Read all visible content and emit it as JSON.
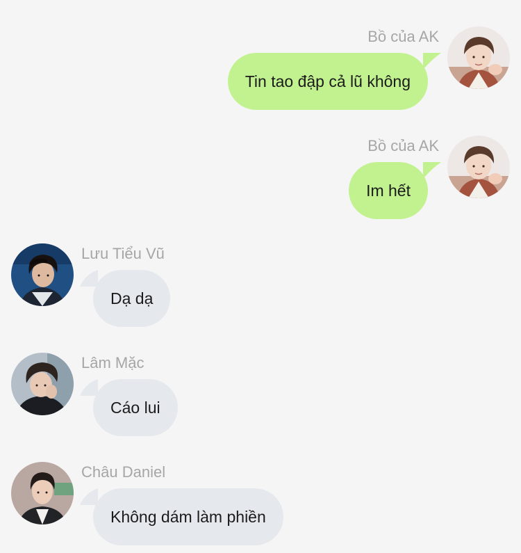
{
  "colors": {
    "background": "#f5f5f5",
    "outgoing_bubble": "#c2f28f",
    "incoming_bubble": "#e5e8ec",
    "sender_name": "#a6a6a6",
    "message_text": "#1b1b1b"
  },
  "messages": [
    {
      "sender": "Bồ của AK",
      "text": "Tin tao đập cả lũ không",
      "direction": "outgoing",
      "avatar_icon": "avatar-bo-cua-ak-icon"
    },
    {
      "sender": "Bồ của AK",
      "text": "Im hết",
      "direction": "outgoing",
      "avatar_icon": "avatar-bo-cua-ak-icon"
    },
    {
      "sender": "Lưu Tiểu Vũ",
      "text": "Dạ dạ",
      "direction": "incoming",
      "avatar_icon": "avatar-luu-tieu-vu-icon"
    },
    {
      "sender": "Lâm Mặc",
      "text": "Cáo lui",
      "direction": "incoming",
      "avatar_icon": "avatar-lam-mac-icon"
    },
    {
      "sender": "Châu Daniel",
      "text": "Không dám làm phiền",
      "direction": "incoming",
      "avatar_icon": "avatar-chau-daniel-icon"
    }
  ]
}
